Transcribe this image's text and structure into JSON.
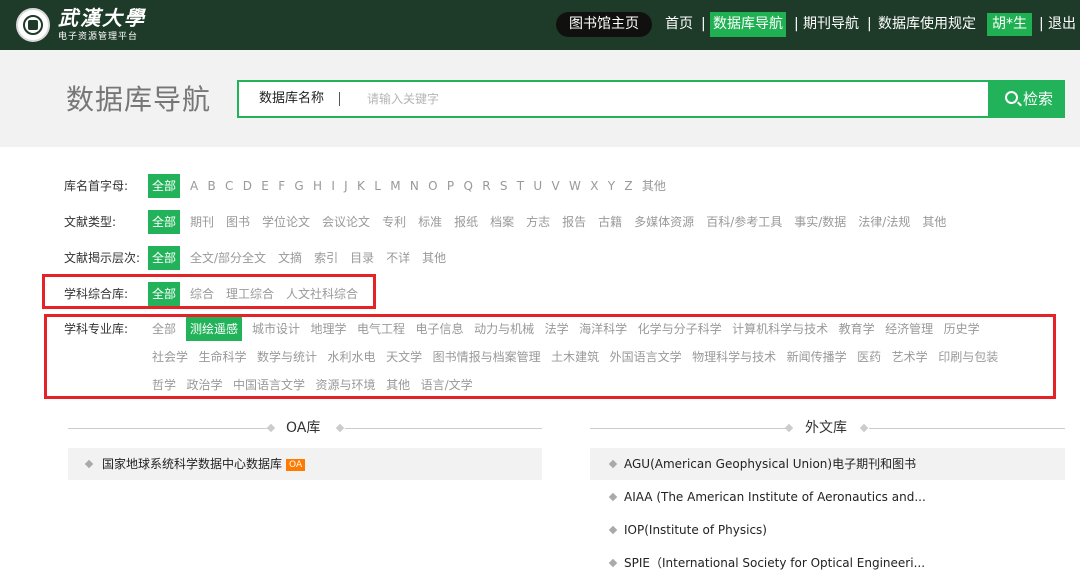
{
  "header": {
    "logo_text": "武漢大學",
    "logo_subtitle": "电子资源管理平台",
    "home_button": "图书馆主页",
    "nav": [
      "首页",
      "数据库导航",
      "期刊导航",
      "数据库使用规定"
    ],
    "active_nav": "数据库导航",
    "separator": "|",
    "user": "胡*生",
    "logout": "退出"
  },
  "search": {
    "page_title": "数据库导航",
    "field_label": "数据库名称",
    "placeholder": "请输入关键字",
    "button": "检索"
  },
  "filters": {
    "initial": {
      "label": "库名首字母:",
      "selected": "全部",
      "options": [
        "A",
        "B",
        "C",
        "D",
        "E",
        "F",
        "G",
        "H",
        "I",
        "J",
        "K",
        "L",
        "M",
        "N",
        "O",
        "P",
        "Q",
        "R",
        "S",
        "T",
        "U",
        "V",
        "W",
        "X",
        "Y",
        "Z",
        "其他"
      ]
    },
    "doc_type": {
      "label": "文献类型:",
      "selected": "全部",
      "options": [
        "期刊",
        "图书",
        "学位论文",
        "会议论文",
        "专利",
        "标准",
        "报纸",
        "档案",
        "方志",
        "报告",
        "古籍",
        "多媒体资源",
        "百科/参考工具",
        "事实/数据",
        "法律/法规",
        "其他"
      ]
    },
    "reveal_level": {
      "label": "文献揭示层次:",
      "selected": "全部",
      "options": [
        "全文/部分全文",
        "文摘",
        "索引",
        "目录",
        "不详",
        "其他"
      ]
    },
    "subject_general": {
      "label": "学科综合库:",
      "selected": "全部",
      "options": [
        "综合",
        "理工综合",
        "人文社科综合"
      ]
    },
    "subject_specific": {
      "label": "学科专业库:",
      "first": "全部",
      "selected": "测绘遥感",
      "row1": [
        "城市设计",
        "地理学",
        "电气工程",
        "电子信息",
        "动力与机械",
        "法学",
        "海洋科学",
        "化学与分子科学",
        "计算机科学与技术",
        "教育学",
        "经济管理",
        "历史学"
      ],
      "row2": [
        "社会学",
        "生命科学",
        "数学与统计",
        "水利水电",
        "天文学",
        "图书情报与档案管理",
        "土木建筑",
        "外国语言文学",
        "物理科学与技术",
        "新闻传播学",
        "医药",
        "艺术学",
        "印刷与包装"
      ],
      "row3": [
        "哲学",
        "政治学",
        "中国语言文学",
        "资源与环境",
        "其他",
        "语言/文学"
      ]
    }
  },
  "oa_section": {
    "title": "OA库",
    "items": [
      {
        "name": "国家地球系统科学数据中心数据库",
        "badge": "OA"
      }
    ]
  },
  "foreign_section": {
    "title": "外文库",
    "items": [
      {
        "name": "AGU(American Geophysical Union)电子期刊和图书"
      },
      {
        "name": "AIAA (The American Institute of Aeronautics and..."
      },
      {
        "name": "IOP(Institute of Physics)"
      },
      {
        "name": "SPIE（International Society for Optical Engineeri..."
      }
    ]
  },
  "colors": {
    "header_bg": "#1e3a28",
    "accent_green": "#22b35a",
    "highlight_red": "#e32328",
    "oa_badge": "#ff7a00"
  }
}
